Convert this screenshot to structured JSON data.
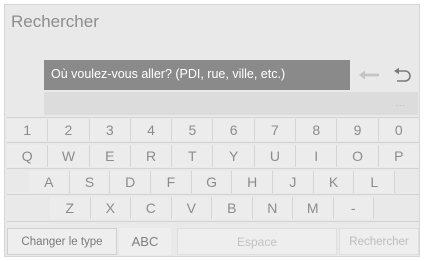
{
  "header": {
    "title": "Rechercher"
  },
  "search": {
    "value": "Où voulez-vous aller? (PDI, rue, ville, etc.)"
  },
  "suggestions": {
    "dots": "..."
  },
  "keyboard": {
    "row1": [
      "1",
      "2",
      "3",
      "4",
      "5",
      "6",
      "7",
      "8",
      "9",
      "0"
    ],
    "row2": [
      "Q",
      "W",
      "E",
      "R",
      "T",
      "Y",
      "U",
      "I",
      "O",
      "P"
    ],
    "row3": [
      "A",
      "S",
      "D",
      "F",
      "G",
      "H",
      "J",
      "K",
      "L"
    ],
    "row4": [
      "Z",
      "X",
      "C",
      "V",
      "B",
      "N",
      "M",
      "-"
    ]
  },
  "bottom": {
    "change_type": "Changer le type",
    "mode": "ABC",
    "space": "Espace",
    "search": "Rechercher"
  },
  "icons": {
    "back": "left-arrow-icon",
    "undo": "undo-arrow-icon"
  }
}
